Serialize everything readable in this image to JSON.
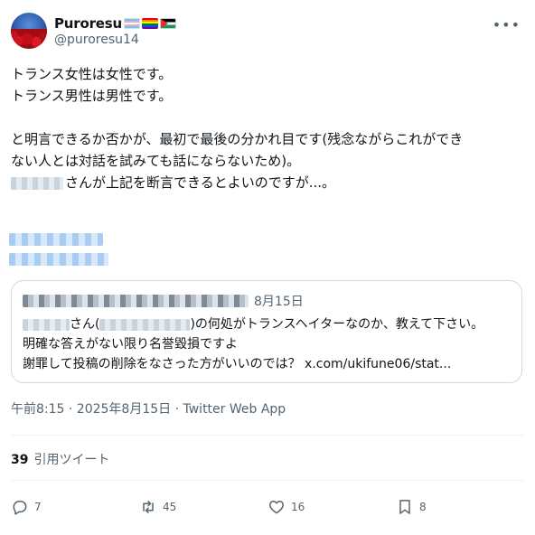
{
  "author": {
    "display_name": "Puroresu",
    "handle": "@puroresu14",
    "badges": [
      "transgender-flag",
      "rainbow-flag",
      "palestine-flag"
    ]
  },
  "tweet": {
    "line1": "トランス女性は女性です。",
    "line2": "トランス男性は男性です。",
    "line3": "と明言できるか否かが、最初で最後の分かれ目です(残念ながらこれができ",
    "line4": "ない人とは対話を試みても話にならないため)。",
    "line5_suffix": "さんが上記を断言できるとよいのですが...。"
  },
  "quoted_tweet": {
    "date": "8月15日",
    "line1_a": "さん(",
    "line1_b": ")の何処がトランスヘイターなのか、教えて下さい。",
    "line2": "明確な答えがない限り名誉毀損ですよ",
    "line3": "謝罪して投稿の削除をなさった方がいいのでは？ x.com/ukifune06/stat..."
  },
  "meta": "午前8:15 · 2025年8月15日 · Twitter Web App",
  "quotes": {
    "count": "39",
    "label": "引用ツイート"
  },
  "actions": {
    "replies": "7",
    "retweets": "45",
    "likes": "16",
    "bookmarks": "8"
  }
}
